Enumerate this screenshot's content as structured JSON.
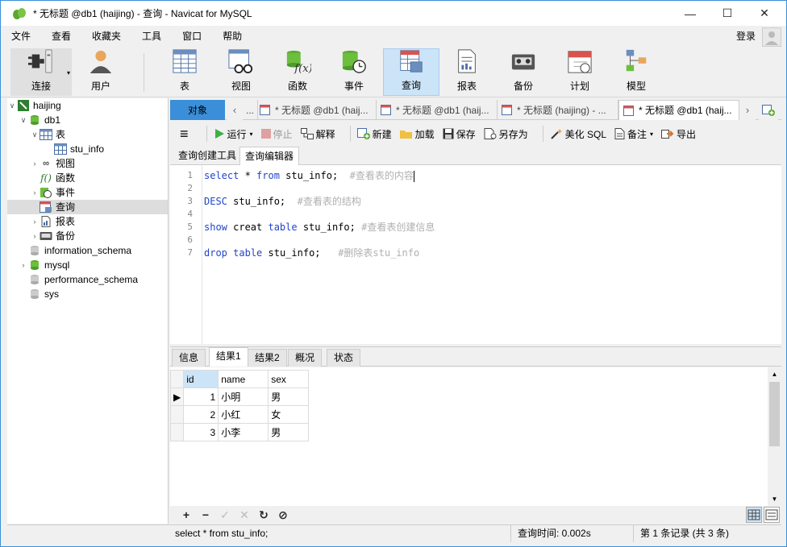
{
  "window": {
    "title": "* 无标题 @db1 (haijing) - 查询 - Navicat for MySQL"
  },
  "menu": [
    "文件",
    "查看",
    "收藏夹",
    "工具",
    "窗口",
    "帮助"
  ],
  "login_label": "登录",
  "toolbar": {
    "connect": "连接",
    "user": "用户",
    "table": "表",
    "view": "视图",
    "function": "函数",
    "event": "事件",
    "query": "查询",
    "report": "报表",
    "backup": "备份",
    "schedule": "计划",
    "model": "模型"
  },
  "tree": {
    "connection": "haijing",
    "db": "db1",
    "tables": "表",
    "table_item": "stu_info",
    "views": "视图",
    "functions": "函数",
    "events": "事件",
    "queries": "查询",
    "reports": "报表",
    "backups": "备份",
    "other_dbs": [
      "information_schema",
      "mysql",
      "performance_schema",
      "sys"
    ]
  },
  "tabs": {
    "objects": "对象",
    "items": [
      "* 无标题 @db1 (haij...",
      "* 无标题 @db1 (haij...",
      "* 无标题 (haijing) - ...",
      "* 无标题 @db1 (haij..."
    ]
  },
  "query_toolbar": {
    "run": "运行",
    "stop": "停止",
    "explain": "解释",
    "new": "新建",
    "load": "加载",
    "save": "保存",
    "save_as": "另存为",
    "beautify": "美化 SQL",
    "comment": "备注",
    "export": "导出"
  },
  "subtabs": [
    "查询创建工具",
    "查询编辑器"
  ],
  "editor": {
    "line_numbers": [
      "1",
      "2",
      "3",
      "4",
      "5",
      "6",
      "7"
    ],
    "l1": {
      "kw1": "select",
      "t1": " * ",
      "kw2": "from",
      "t2": " stu_info;  ",
      "cm": "#查看表的内容"
    },
    "l3": {
      "kw1": "DESC",
      "t1": " stu_info;  ",
      "cm": "#查看表的结构"
    },
    "l5": {
      "kw1": "show",
      "t1": " creat ",
      "kw2": "table",
      "t2": " stu_info; ",
      "cm": "#查看表创建信息"
    },
    "l7": {
      "kw1": "drop",
      "t1": " ",
      "kw2": "table",
      "t2": " stu_info;   ",
      "cm": "#删除表stu_info"
    }
  },
  "result_tabs": [
    "信息",
    "结果1",
    "结果2",
    "概况",
    "状态"
  ],
  "grid": {
    "columns": [
      "id",
      "name",
      "sex"
    ],
    "rows": [
      {
        "id": "1",
        "name": "小明",
        "sex": "男"
      },
      {
        "id": "2",
        "name": "小红",
        "sex": "女"
      },
      {
        "id": "3",
        "name": "小李",
        "sex": "男"
      }
    ]
  },
  "status": {
    "sql": "select * from stu_info;",
    "time": "查询时间: 0.002s",
    "records": "第 1 条记录 (共 3 条)"
  },
  "colors": {
    "accent": "#3a8fd8",
    "keyword": "#2244cc",
    "comment": "#b0b0b0",
    "selected": "#cce4f7"
  }
}
